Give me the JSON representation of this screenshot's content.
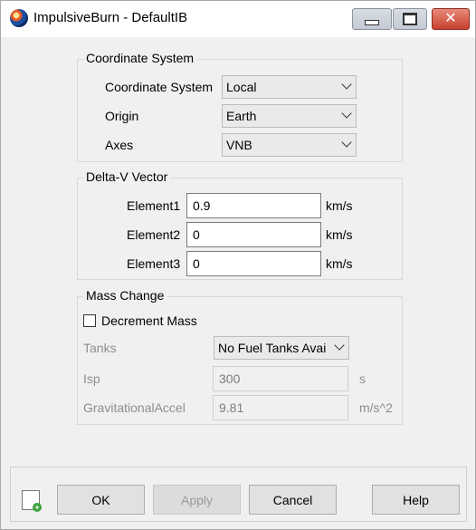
{
  "window": {
    "title": "ImpulsiveBurn - DefaultIB"
  },
  "coordinate_system": {
    "group_title": "Coordinate System",
    "coord_label": "Coordinate System",
    "coord_value": "Local",
    "origin_label": "Origin",
    "origin_value": "Earth",
    "axes_label": "Axes",
    "axes_value": "VNB"
  },
  "delta_v": {
    "group_title": "Delta-V Vector",
    "elements": [
      {
        "label": "Element1",
        "value": "0.9",
        "unit": "km/s"
      },
      {
        "label": "Element2",
        "value": "0",
        "unit": "km/s"
      },
      {
        "label": "Element3",
        "value": "0",
        "unit": "km/s"
      }
    ]
  },
  "mass_change": {
    "group_title": "Mass Change",
    "decrement_label": "Decrement Mass",
    "decrement_checked": false,
    "tanks_label": "Tanks",
    "tanks_value": "No Fuel Tanks Avai",
    "isp_label": "Isp",
    "isp_value": "300",
    "isp_unit": "s",
    "grav_label": "GravitationalAccel",
    "grav_value": "9.81",
    "grav_unit": "m/s^2"
  },
  "buttons": {
    "ok": "OK",
    "apply": "Apply",
    "cancel": "Cancel",
    "help": "Help"
  }
}
